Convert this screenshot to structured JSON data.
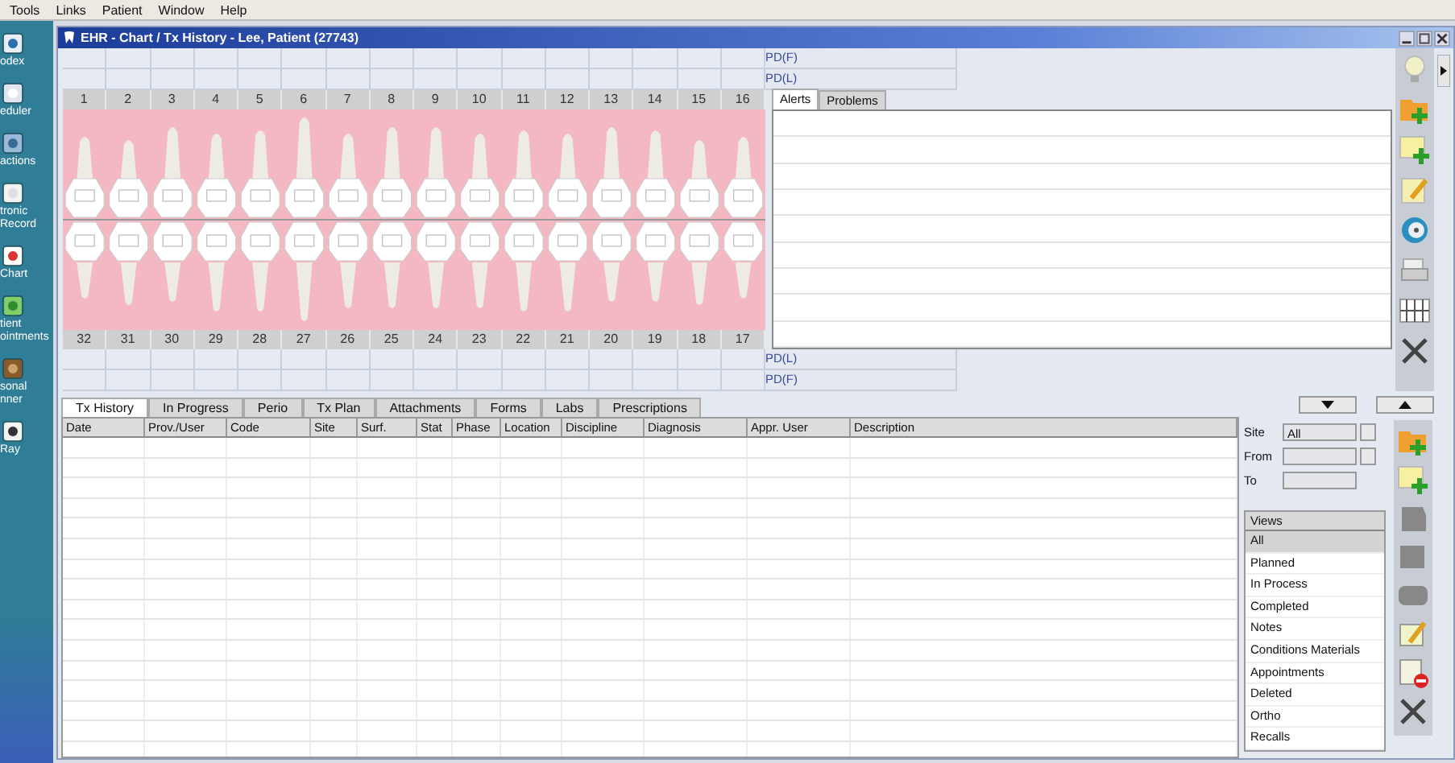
{
  "menu": [
    "Tools",
    "Links",
    "Patient",
    "Window",
    "Help"
  ],
  "sidebar": [
    {
      "lines": [
        "odex"
      ]
    },
    {
      "lines": [
        "eduler"
      ]
    },
    {
      "lines": [
        "actions"
      ]
    },
    {
      "lines": [
        "tronic",
        "Record"
      ]
    },
    {
      "lines": [
        "Chart"
      ]
    },
    {
      "lines": [
        "tient",
        "ointments"
      ]
    },
    {
      "lines": [
        "sonal",
        "nner"
      ]
    },
    {
      "lines": [
        "Ray"
      ]
    }
  ],
  "window": {
    "title": "EHR - Chart / Tx History - Lee, Patient (27743)"
  },
  "chart": {
    "upper_numbers": [
      "1",
      "2",
      "3",
      "4",
      "5",
      "6",
      "7",
      "8",
      "9",
      "10",
      "11",
      "12",
      "13",
      "14",
      "15",
      "16"
    ],
    "lower_numbers": [
      "32",
      "31",
      "30",
      "29",
      "28",
      "27",
      "26",
      "25",
      "24",
      "23",
      "22",
      "21",
      "20",
      "19",
      "18",
      "17"
    ],
    "pd_upper": [
      "PD(F)",
      "PD(L)"
    ],
    "pd_lower": [
      "PD(L)",
      "PD(F)"
    ]
  },
  "side_tabs": [
    {
      "label": "Alerts",
      "selected": true
    },
    {
      "label": "Problems",
      "selected": false
    }
  ],
  "tabs": [
    {
      "label": "Tx History",
      "selected": true
    },
    {
      "label": "In Progress",
      "selected": false
    },
    {
      "label": "Perio",
      "selected": false
    },
    {
      "label": "Tx Plan",
      "selected": false
    },
    {
      "label": "Attachments",
      "selected": false
    },
    {
      "label": "Forms",
      "selected": false
    },
    {
      "label": "Labs",
      "selected": false
    },
    {
      "label": "Prescriptions",
      "selected": false
    }
  ],
  "table": {
    "columns": [
      "Date",
      "Prov./User",
      "Code",
      "Site",
      "Surf.",
      "Stat",
      "Phase",
      "Location",
      "Discipline",
      "Diagnosis",
      "Appr. User",
      "Description"
    ]
  },
  "filters": {
    "site_label": "Site",
    "site_value": "All",
    "from_label": "From",
    "to_label": "To"
  },
  "views": {
    "header": "Views",
    "items": [
      {
        "label": "All",
        "selected": true
      },
      {
        "label": "Planned",
        "selected": false
      },
      {
        "label": "In Process",
        "selected": false
      },
      {
        "label": "Completed",
        "selected": false
      },
      {
        "label": "Notes",
        "selected": false
      },
      {
        "label": "Conditions Materials",
        "selected": false
      },
      {
        "label": "Appointments",
        "selected": false
      },
      {
        "label": "Deleted",
        "selected": false
      },
      {
        "label": "Ortho",
        "selected": false
      },
      {
        "label": "Recalls",
        "selected": false
      }
    ]
  }
}
